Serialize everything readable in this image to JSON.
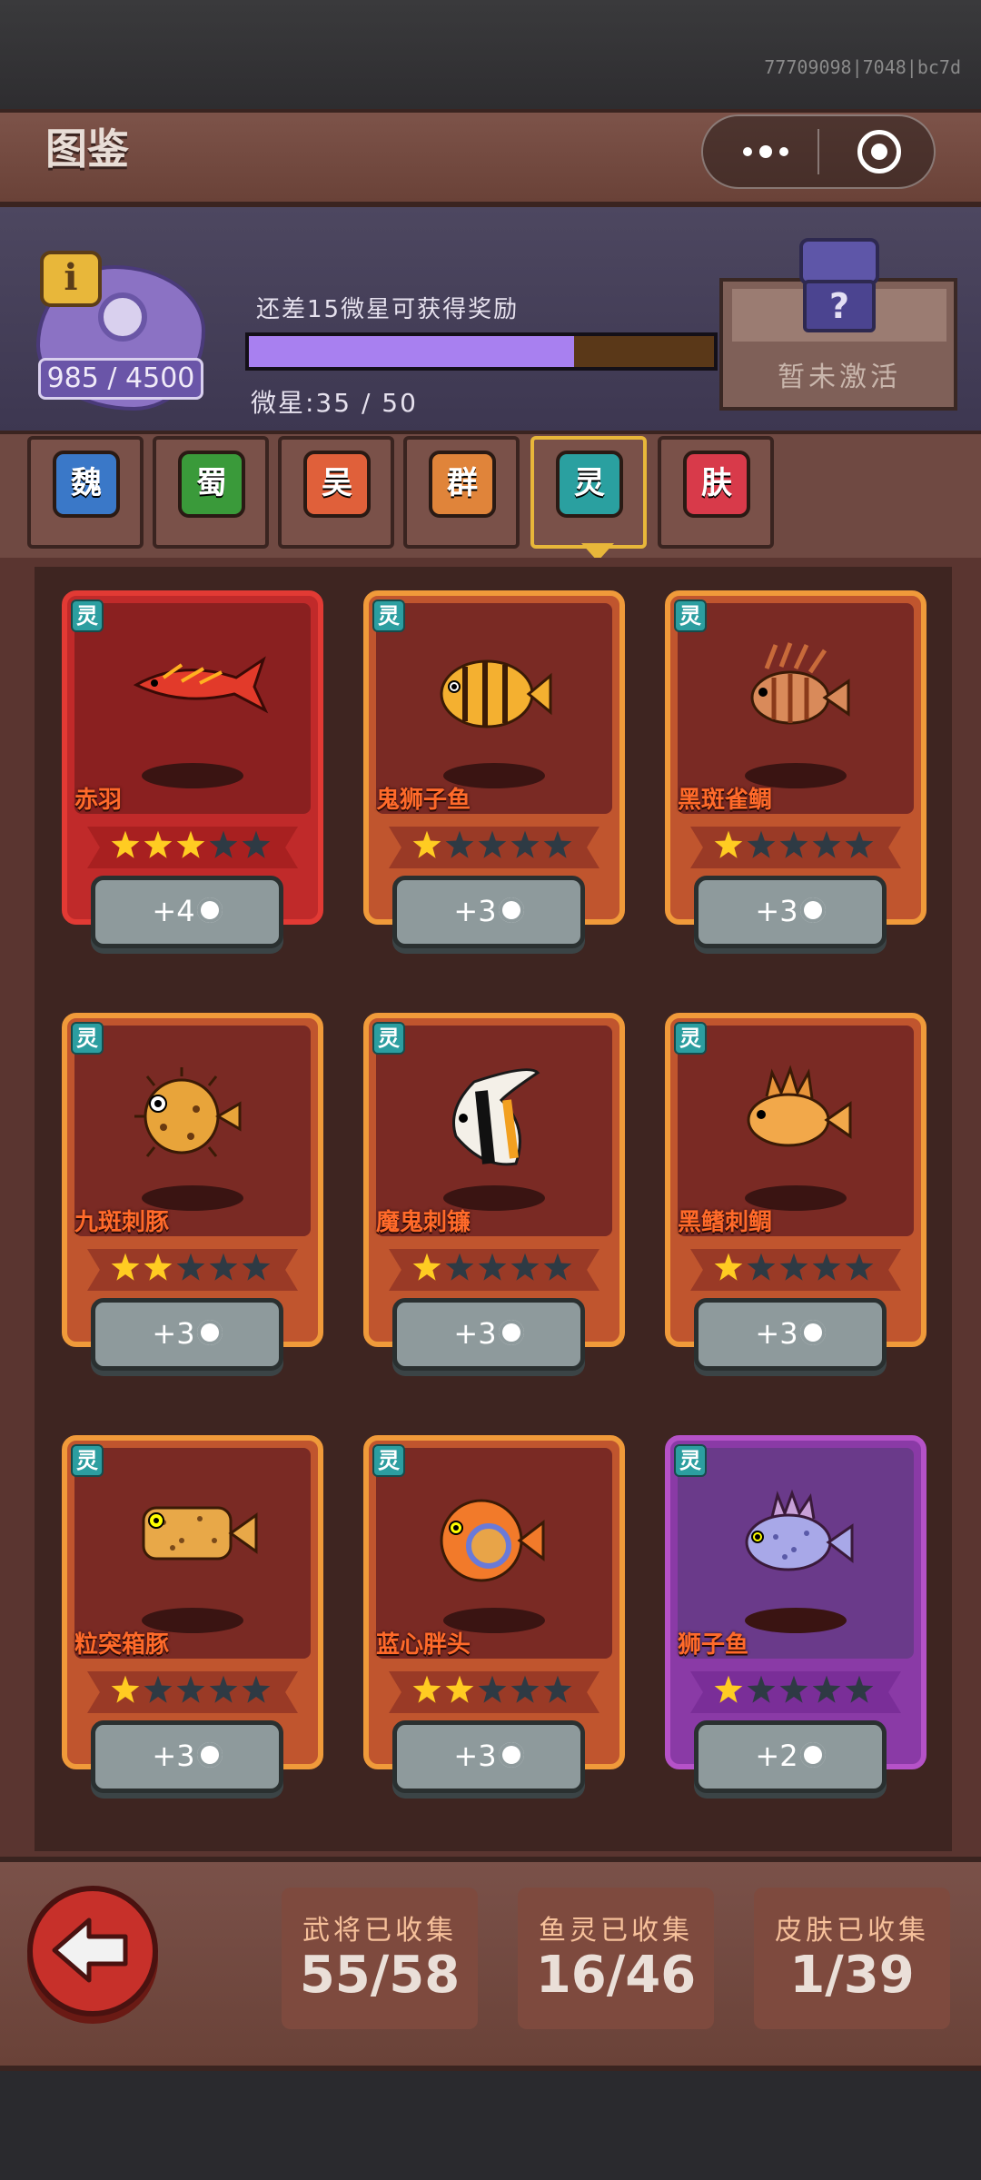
{
  "build_id": "77709098|7048|bc7d",
  "header": {
    "title": "图鉴",
    "score": "985 / 4500",
    "reward_hint": "还差15微星可获得奖励",
    "star_count": "微星:35 / 50",
    "progress": 0.7,
    "reward_status": "暂未激活",
    "chest_symbol": "?"
  },
  "tabs": [
    {
      "label": "魏",
      "color": "#3a78c8"
    },
    {
      "label": "蜀",
      "color": "#3a9a3a"
    },
    {
      "label": "吴",
      "color": "#e0603a"
    },
    {
      "label": "群",
      "color": "#e0843a"
    },
    {
      "label": "灵",
      "color": "#2aa0a0",
      "active": true
    },
    {
      "label": "肤",
      "color": "#d83a4a"
    }
  ],
  "type_badge": "灵",
  "cards": [
    {
      "name": "赤羽",
      "stars": 3,
      "reward": "+4",
      "style": "red",
      "fish": "red-fish"
    },
    {
      "name": "鬼狮子鱼",
      "stars": 1,
      "reward": "+3",
      "style": "orange",
      "fish": "striped-fish"
    },
    {
      "name": "黑斑雀鲷",
      "stars": 1,
      "reward": "+3",
      "style": "orange",
      "fish": "lionfish"
    },
    {
      "name": "九斑刺豚",
      "stars": 2,
      "reward": "+3",
      "style": "orange",
      "fish": "pufferfish"
    },
    {
      "name": "魔鬼刺镰",
      "stars": 1,
      "reward": "+3",
      "style": "orange",
      "fish": "moorish-idol"
    },
    {
      "name": "黑鳍刺鲷",
      "stars": 1,
      "reward": "+3",
      "style": "orange",
      "fish": "spiny-fish"
    },
    {
      "name": "粒突箱豚",
      "stars": 1,
      "reward": "+3",
      "style": "orange",
      "fish": "boxfish"
    },
    {
      "name": "蓝心胖头",
      "stars": 2,
      "reward": "+3",
      "style": "orange",
      "fish": "round-fish"
    },
    {
      "name": "狮子鱼",
      "stars": 1,
      "reward": "+2",
      "style": "purple",
      "fish": "purple-fish"
    }
  ],
  "stats": [
    {
      "label": "武将已收集",
      "value": "55/58"
    },
    {
      "label": "鱼灵已收集",
      "value": "16/46"
    },
    {
      "label": "皮肤已收集",
      "value": "1/39"
    }
  ]
}
